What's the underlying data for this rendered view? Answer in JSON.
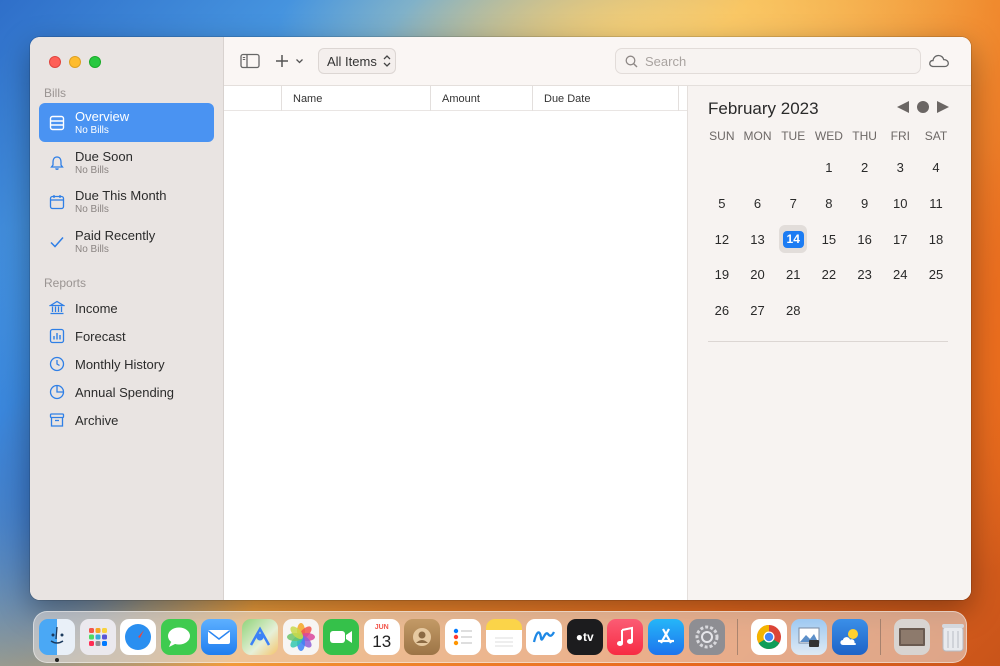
{
  "sidebar": {
    "bills_header": "Bills",
    "reports_header": "Reports",
    "items": [
      {
        "label": "Overview",
        "sub": "No Bills"
      },
      {
        "label": "Due Soon",
        "sub": "No Bills"
      },
      {
        "label": "Due This Month",
        "sub": "No Bills"
      },
      {
        "label": "Paid Recently",
        "sub": "No Bills"
      }
    ],
    "reports": [
      {
        "label": "Income"
      },
      {
        "label": "Forecast"
      },
      {
        "label": "Monthly History"
      },
      {
        "label": "Annual Spending"
      },
      {
        "label": "Archive"
      }
    ]
  },
  "toolbar": {
    "filter_label": "All Items",
    "search_placeholder": "Search"
  },
  "table": {
    "columns": [
      "Name",
      "Amount",
      "Due Date"
    ]
  },
  "calendar": {
    "title": "February 2023",
    "weekdays": [
      "SUN",
      "MON",
      "TUE",
      "WED",
      "THU",
      "FRI",
      "SAT"
    ],
    "weeks": [
      [
        "",
        "",
        "",
        "1",
        "2",
        "3",
        "4"
      ],
      [
        "5",
        "6",
        "7",
        "8",
        "9",
        "10",
        "11"
      ],
      [
        "12",
        "13",
        "14",
        "15",
        "16",
        "17",
        "18"
      ],
      [
        "19",
        "20",
        "21",
        "22",
        "23",
        "24",
        "25"
      ],
      [
        "26",
        "27",
        "28",
        "",
        "",
        "",
        ""
      ]
    ],
    "today": "14"
  },
  "dock": {
    "apps": [
      {
        "name": "finder-icon",
        "color": "#3d9bf2"
      },
      {
        "name": "launchpad-icon",
        "color": "#e8e6ea"
      },
      {
        "name": "safari-icon",
        "color": "#2b8ff0"
      },
      {
        "name": "messages-icon",
        "color": "#3fcb4f"
      },
      {
        "name": "mail-icon",
        "color": "#3a8ef5"
      },
      {
        "name": "maps-icon",
        "color": "#6cc46a"
      },
      {
        "name": "photos-icon",
        "color": "#f5f3f1"
      },
      {
        "name": "facetime-icon",
        "color": "#35c14a"
      },
      {
        "name": "calendar-icon",
        "color": "#ffffff"
      },
      {
        "name": "contacts-icon",
        "color": "#b08a5c"
      },
      {
        "name": "reminders-icon",
        "color": "#ffffff"
      },
      {
        "name": "notes-icon",
        "color": "#fbd449"
      },
      {
        "name": "freeform-icon",
        "color": "#ffffff"
      },
      {
        "name": "tv-icon",
        "color": "#1c1c1e"
      },
      {
        "name": "music-icon",
        "color": "#f84159"
      },
      {
        "name": "app-store-icon",
        "color": "#1d8df1"
      },
      {
        "name": "system-settings-icon",
        "color": "#8e8e93"
      }
    ],
    "calendar_month": "JUN",
    "calendar_day": "13",
    "tv_label": "tv"
  }
}
